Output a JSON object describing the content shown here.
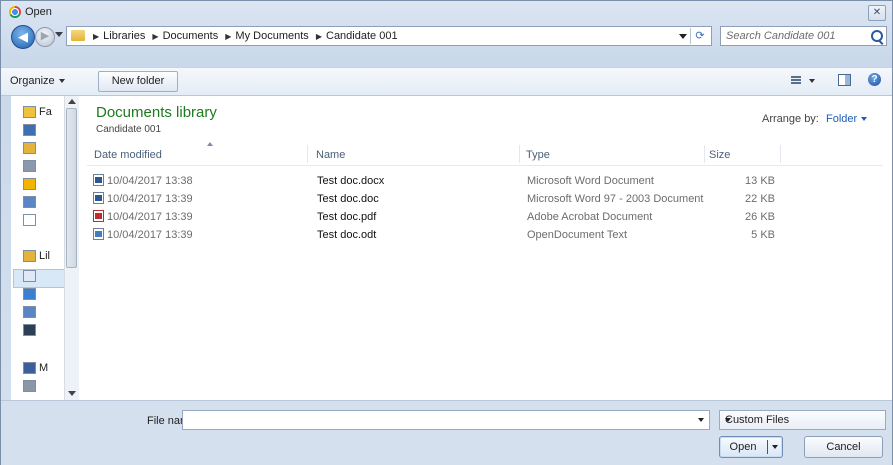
{
  "window": {
    "title": "Open",
    "close_glyph": "✕"
  },
  "nav": {
    "back_glyph": "◀",
    "forward_glyph": "▶",
    "breadcrumbs": [
      "Libraries",
      "Documents",
      "My Documents",
      "Candidate 001"
    ],
    "breadcrumb_separator": "▶",
    "refresh_glyph": "⟳",
    "search_placeholder": "Search Candidate 001"
  },
  "toolbar": {
    "organize": "Organize",
    "new_folder": "New folder",
    "help_glyph": "?"
  },
  "navpane": {
    "items": [
      {
        "label": "Fa",
        "icon": "star-icon"
      },
      {
        "label": "",
        "icon": "desktop-icon"
      },
      {
        "label": "",
        "icon": "downloads-icon"
      },
      {
        "label": "",
        "icon": "recent-places-icon"
      },
      {
        "label": "",
        "icon": "google-drive-icon"
      },
      {
        "label": "",
        "icon": "pictures-icon"
      },
      {
        "label": "",
        "icon": "blank-file-icon"
      },
      {
        "label": "Lil",
        "icon": "libraries-icon"
      },
      {
        "label": "",
        "icon": "documents-icon"
      },
      {
        "label": "",
        "icon": "music-icon"
      },
      {
        "label": "",
        "icon": "pictures-icon"
      },
      {
        "label": "",
        "icon": "videos-icon"
      },
      {
        "label": "M",
        "icon": "computer-icon"
      },
      {
        "label": "",
        "icon": "network-drive-icon"
      }
    ]
  },
  "library": {
    "title": "Documents library",
    "subtitle": "Candidate 001",
    "arrange_label": "Arrange by:",
    "arrange_value": "Folder"
  },
  "columns": [
    "Date modified",
    "Name",
    "Type",
    "Size"
  ],
  "files": [
    {
      "date": "10/04/2017 13:38",
      "name": "Test doc.docx",
      "type": "Microsoft Word Document",
      "size": "13 KB",
      "icon": "word-doc-icon",
      "color": "#2b5797"
    },
    {
      "date": "10/04/2017 13:39",
      "name": "Test doc.doc",
      "type": "Microsoft Word 97 - 2003 Document",
      "size": "22 KB",
      "icon": "word-doc-icon",
      "color": "#2b5797"
    },
    {
      "date": "10/04/2017 13:39",
      "name": "Test doc.pdf",
      "type": "Adobe Acrobat Document",
      "size": "26 KB",
      "icon": "pdf-icon",
      "color": "#c02b2b"
    },
    {
      "date": "10/04/2017 13:39",
      "name": "Test doc.odt",
      "type": "OpenDocument Text",
      "size": "5 KB",
      "icon": "odt-icon",
      "color": "#3f7fbf"
    }
  ],
  "bottom": {
    "file_name_label": "File name:",
    "file_name_value": "",
    "filter_value": "Custom Files",
    "open_label": "Open",
    "cancel_label": "Cancel"
  },
  "colors": {
    "accent": "#1a5fb4",
    "library_title": "#1e7a1e"
  }
}
